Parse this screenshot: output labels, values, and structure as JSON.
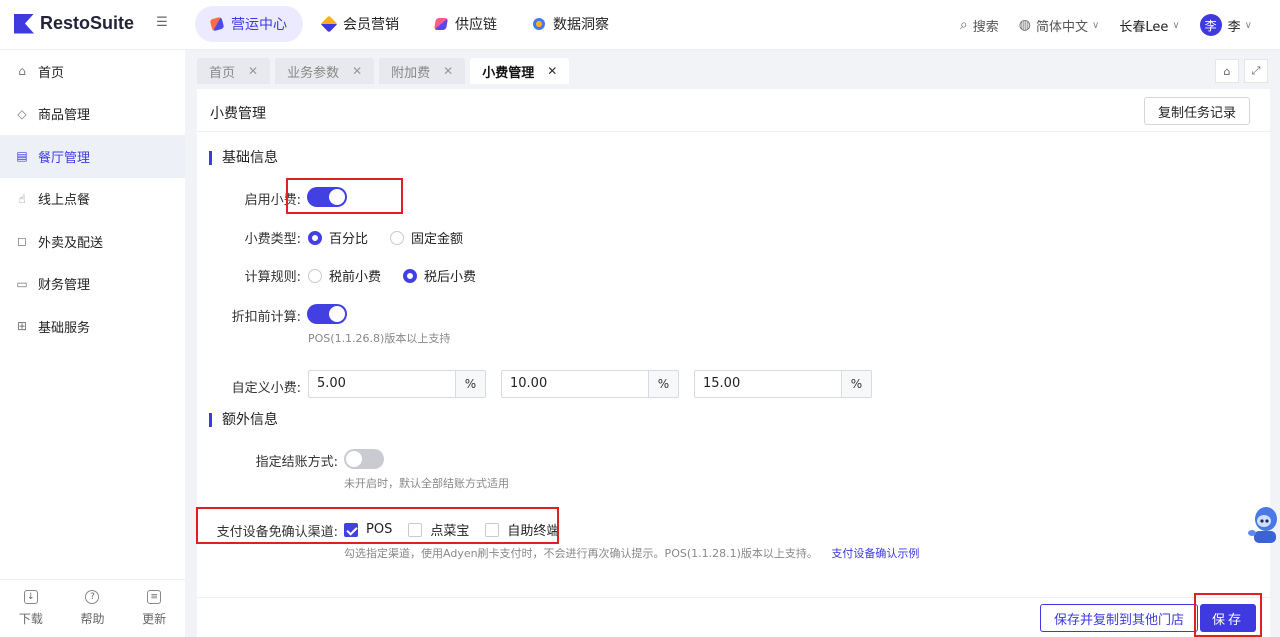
{
  "app": {
    "logo_text": "RestoSuite"
  },
  "nav": {
    "items": [
      {
        "label": "营运中心"
      },
      {
        "label": "会员营销"
      },
      {
        "label": "供应链"
      },
      {
        "label": "数据洞察"
      }
    ]
  },
  "header": {
    "search_label": "搜索",
    "language_label": "简体中文",
    "store_label": "长春Lee",
    "avatar_text": "李",
    "user_name": "李"
  },
  "sidebar": {
    "items": [
      {
        "label": "首页"
      },
      {
        "label": "商品管理"
      },
      {
        "label": "餐厅管理"
      },
      {
        "label": "线上点餐"
      },
      {
        "label": "外卖及配送"
      },
      {
        "label": "财务管理"
      },
      {
        "label": "基础服务"
      }
    ],
    "bottom": [
      {
        "label": "下载"
      },
      {
        "label": "帮助"
      },
      {
        "label": "更新"
      }
    ]
  },
  "tabs": [
    {
      "label": "首页"
    },
    {
      "label": "业务参数"
    },
    {
      "label": "附加费"
    },
    {
      "label": "小费管理"
    }
  ],
  "page": {
    "title": "小费管理",
    "copy_records_label": "复制任务记录",
    "basic_section": "基础信息",
    "enable_tip_label": "启用小费:",
    "enable_tip_on": true,
    "tip_type_label": "小费类型:",
    "tip_type_options": [
      "百分比",
      "固定金额"
    ],
    "tip_type_selected": "百分比",
    "calc_rule_label": "计算规则:",
    "calc_rule_options": [
      "税前小费",
      "税后小费"
    ],
    "calc_rule_selected": "税后小费",
    "discount_calc_label": "折扣前计算:",
    "discount_calc_on": true,
    "discount_calc_hint": "POS(1.1.26.8)版本以上支持",
    "custom_tip_label": "自定义小费:",
    "custom_tips": [
      {
        "value": "5.00",
        "unit": "%"
      },
      {
        "value": "10.00",
        "unit": "%"
      },
      {
        "value": "15.00",
        "unit": "%"
      }
    ],
    "extra_section": "额外信息",
    "payment_method_label": "指定结账方式:",
    "payment_method_on": false,
    "payment_method_hint": "未开启时，默认全部结账方式适用",
    "device_channel_label": "支付设备免确认渠道:",
    "device_channels": [
      {
        "label": "POS",
        "checked": true
      },
      {
        "label": "点菜宝",
        "checked": false
      },
      {
        "label": "自助终端",
        "checked": false
      }
    ],
    "device_channel_hint": "勾选指定渠道，使用Adyen刷卡支付时，不会进行再次确认提示。POS(1.1.28.1)版本以上支持。",
    "device_channel_link": "支付设备确认示例",
    "save_copy_label": "保存并复制到其他门店",
    "save_label": "保存"
  },
  "colors": {
    "accent": "#3e3ae0",
    "highlight": "#e02020"
  }
}
